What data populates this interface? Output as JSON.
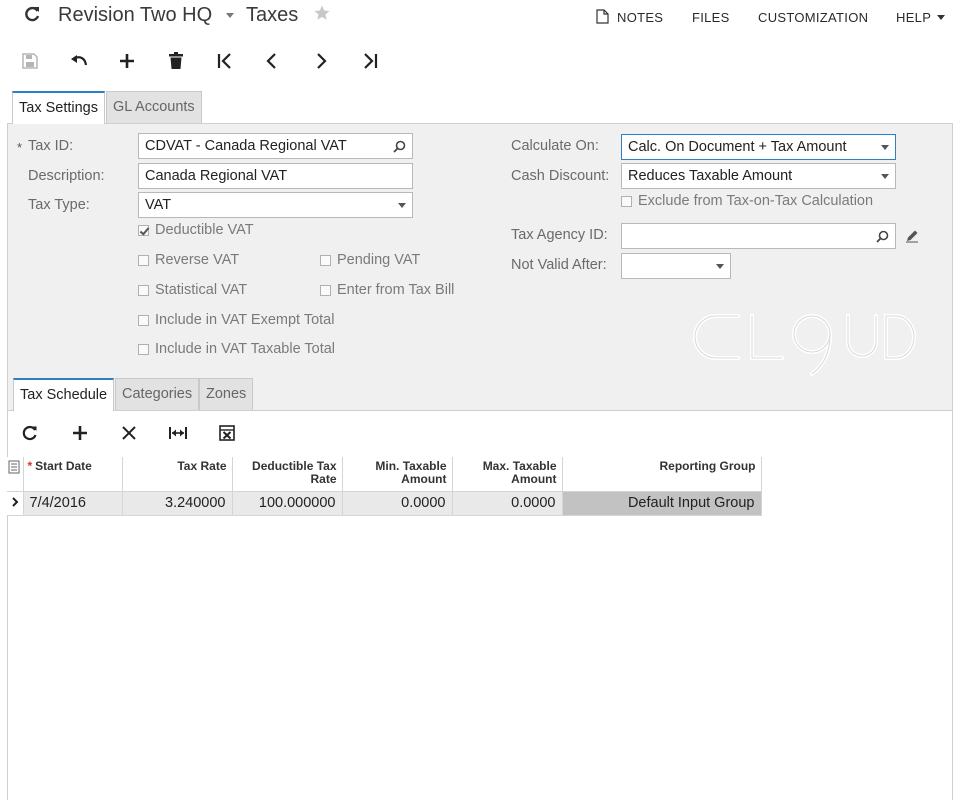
{
  "header": {
    "company": "Revision Two HQ",
    "screen": "Taxes",
    "links": {
      "notes": "NOTES",
      "files": "FILES",
      "customization": "CUSTOMIZATION",
      "help": "HELP"
    }
  },
  "toolbar": [
    "save-icon",
    "undo-icon",
    "add-icon",
    "delete-icon",
    "first-icon",
    "previous-icon",
    "next-icon",
    "last-icon"
  ],
  "tabs": [
    {
      "label": "Tax Settings",
      "active": true
    },
    {
      "label": "GL Accounts",
      "active": false
    }
  ],
  "form": {
    "tax_id": {
      "label": "Tax ID:",
      "required_mark": "*",
      "value": "CDVAT - Canada Regional VAT"
    },
    "description": {
      "label": "Description:",
      "value": "Canada Regional VAT"
    },
    "tax_type": {
      "label": "Tax Type:",
      "value": "VAT"
    },
    "checkboxes": {
      "deductible_vat": {
        "label": "Deductible VAT",
        "checked": true
      },
      "reverse_vat": {
        "label": "Reverse VAT",
        "checked": false
      },
      "pending_vat": {
        "label": "Pending VAT",
        "checked": false
      },
      "statistical_vat": {
        "label": "Statistical VAT",
        "checked": false
      },
      "enter_from_tax_bill": {
        "label": "Enter from Tax Bill",
        "checked": false
      },
      "include_exempt": {
        "label": "Include in VAT Exempt Total",
        "checked": false
      },
      "include_taxable": {
        "label": "Include in VAT Taxable Total",
        "checked": false
      },
      "exclude_tax_on_tax": {
        "label": "Exclude from Tax-on-Tax Calculation",
        "checked": false
      }
    },
    "calculate_on": {
      "label": "Calculate On:",
      "value": "Calc. On Document + Tax Amount"
    },
    "cash_discount": {
      "label": "Cash Discount:",
      "value": "Reduces Taxable Amount"
    },
    "tax_agency_id": {
      "label": "Tax Agency ID:",
      "value": ""
    },
    "not_valid_after": {
      "label": "Not Valid After:",
      "value": ""
    }
  },
  "logo_text": "CLOUD",
  "sub_tabs": [
    {
      "label": "Tax Schedule",
      "active": true
    },
    {
      "label": "Categories",
      "active": false
    },
    {
      "label": "Zones",
      "active": false
    }
  ],
  "grid_toolbar": [
    "refresh-icon",
    "add-row-icon",
    "delete-row-icon",
    "fit-columns-icon",
    "export-excel-icon"
  ],
  "grid": {
    "columns": {
      "start_date": "Start Date",
      "tax_rate": "Tax Rate",
      "deductible_line1": "Deductible Tax",
      "deductible_line2": "Rate",
      "min_line1": "Min. Taxable",
      "min_line2": "Amount",
      "max_line1": "Max. Taxable",
      "max_line2": "Amount",
      "reporting_group": "Reporting Group"
    },
    "rows": [
      {
        "start_date": "7/4/2016",
        "tax_rate": "3.240000",
        "deductible_tax_rate": "100.000000",
        "min_taxable_amount": "0.0000",
        "max_taxable_amount": "0.0000",
        "reporting_group": "Default Input Group"
      }
    ]
  },
  "colors": {
    "accent": "#2f7fc4",
    "panel": "#f0f0f0",
    "selected_cell": "#c2c2c2"
  }
}
